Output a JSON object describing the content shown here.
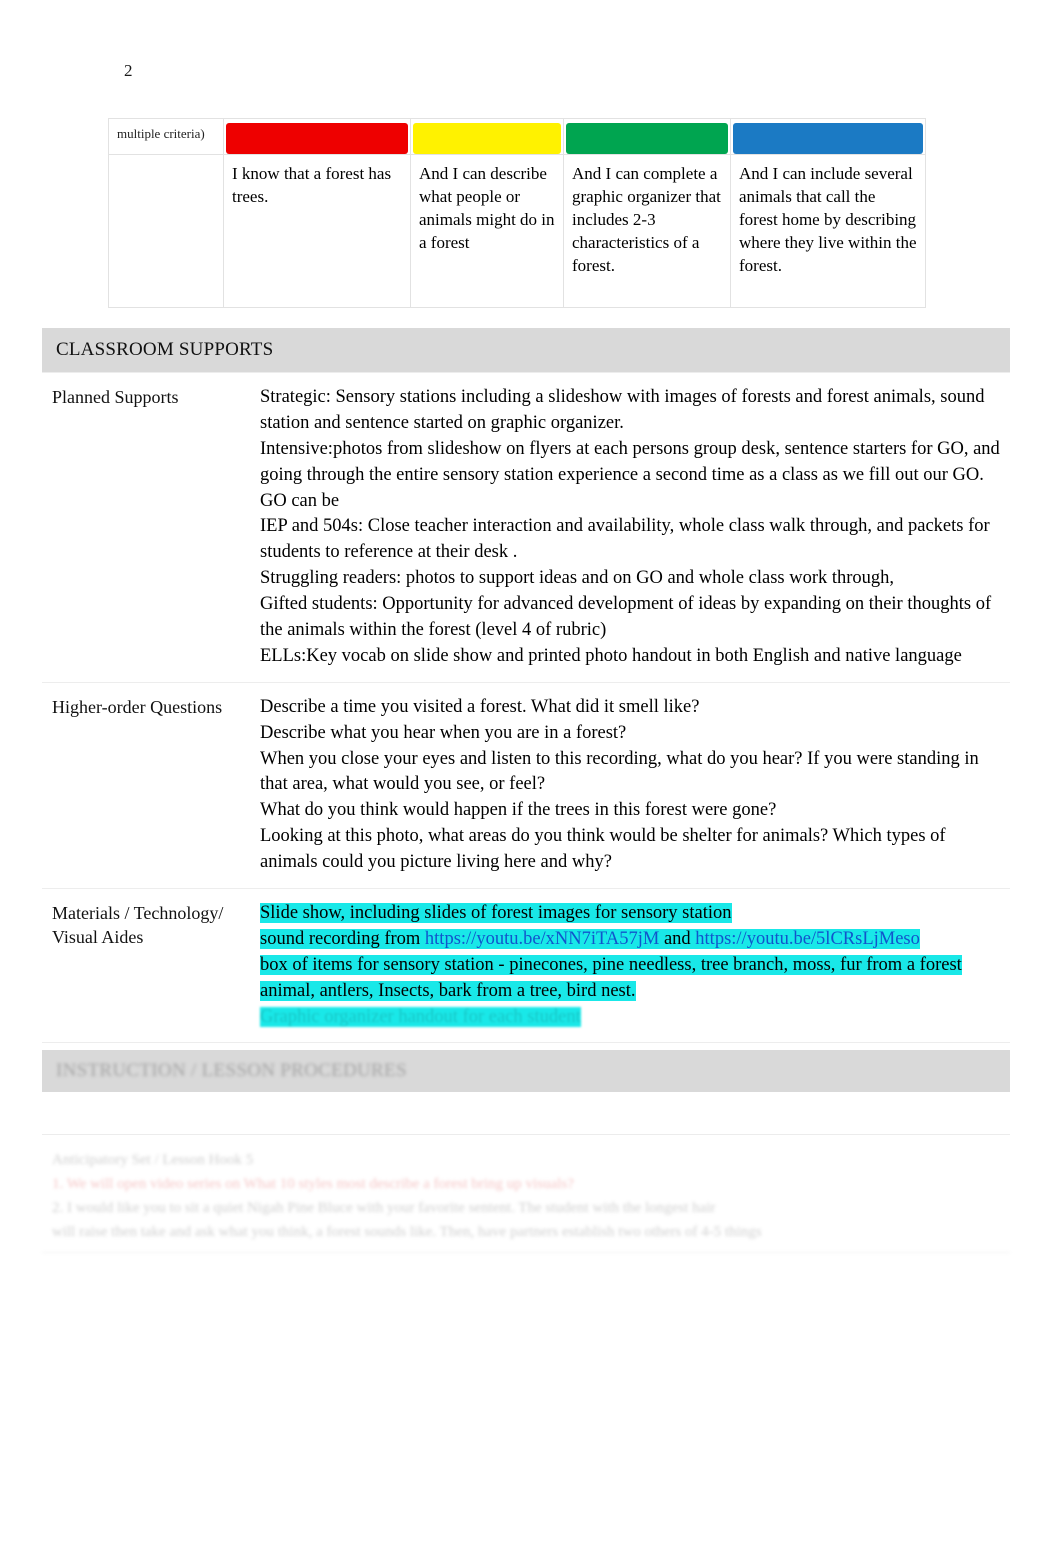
{
  "document": {
    "page_number": "2"
  },
  "rubric": {
    "criteria_label": "multiple criteria)",
    "levels": [
      {
        "color": "#ee0000",
        "name": "red-level-bar",
        "text": "I know that a forest has trees."
      },
      {
        "color": "#fff200",
        "name": "yellow-level-bar",
        "text": "And I can describe what people or animals might do in a forest"
      },
      {
        "color": "#00a550",
        "name": "green-level-bar",
        "text": "And I can complete a graphic organizer that includes 2-3 characteristics of a forest."
      },
      {
        "color": "#1b7ac4",
        "name": "blue-level-bar",
        "text": "And I can include several animals that call the forest home by describing where they live within the forest."
      }
    ]
  },
  "classroom_supports": {
    "header": "CLASSROOM SUPPORTS",
    "rows": {
      "planned_supports": {
        "label": "Planned Supports",
        "lines": [
          "Strategic: Sensory stations including a slideshow with images of forests and forest animals, sound station and sentence started on graphic organizer.",
          "Intensive:photos from slideshow on flyers at each persons group desk, sentence starters for GO, and going through the entire sensory station experience a second time as a class as we fill out our GO. GO can be",
          "IEP and 504s: Close teacher interaction and availability, whole class walk through, and packets for students to reference at their desk .",
          "Struggling readers: photos to support ideas and on GO and whole class work through,",
          "Gifted students: Opportunity for advanced development of ideas by expanding on their thoughts of the animals within the forest (level 4 of rubric)",
          "ELLs:Key vocab on slide show and printed photo handout in both English and native language"
        ]
      },
      "higher_order_questions": {
        "label": "Higher-order Questions",
        "lines": [
          "Describe a time you visited a forest.  What did it smell like?",
          "Describe what you hear when you are in a forest?",
          "When you close your eyes and listen to this recording, what do you hear?  If you were standing in that area, what would you see, or feel?",
          "What do you think would happen if the trees in this forest were gone?",
          "Looking at this photo, what areas do you think would be shelter for animals? Which types of animals could you picture living here and why?"
        ]
      },
      "materials": {
        "label": "Materials / Technology/ Visual Aides",
        "line1": "Slide show, including slides of forest images for sensory station",
        "line2_prefix": "sound recording from ",
        "link1": "https://youtu.be/xNN7iTA57jM",
        "line2_middle": " and ",
        "link2": "https://youtu.be/5lCRsLjMeso",
        "line3": "box of items for sensory station - pinecones, pine needless, tree branch, moss, fur from a forest animal, antlers, Insects, bark from a tree, bird nest.",
        "line4_obscured": "Graphic organizer handout for each student"
      }
    }
  },
  "lower_section": {
    "header_obscured": "INSTRUCTION / LESSON PROCEDURES",
    "body_lines_obscured": [
      "Anticipatory Set / Lesson Hook 5",
      "1.  We will open video series on  What 10 styles most describe a forest bring up visuals?",
      "2.  I would like you to sit a quiet Nigah Pine Bluce with your favorite sentent.  The student with the longest hair",
      "will raise then take and ask what you think, a forest sounds like.  Then, have partners establish two others of 4-5 things"
    ]
  },
  "colors": {
    "highlight": "#19e8e8",
    "link": "#1155cc",
    "section_header_bg": "#d9d9d9"
  }
}
